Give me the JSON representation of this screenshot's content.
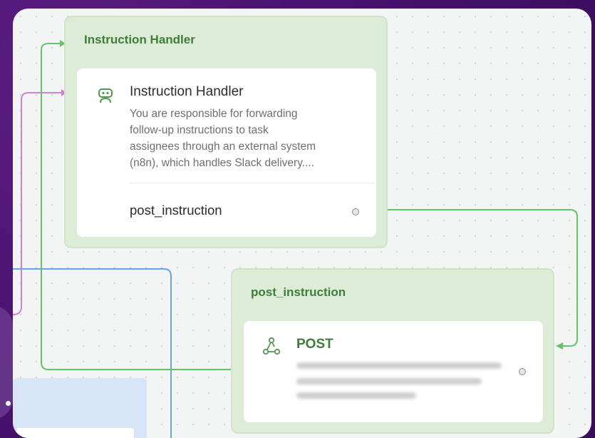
{
  "colors": {
    "group_bg": "#dcecd6",
    "group_title": "#3f7d3a",
    "edge_green": "#67c36b",
    "edge_pink": "#d67fd6",
    "edge_blue": "#6ea0e4"
  },
  "groups": [
    {
      "title": "Instruction Handler",
      "node": {
        "icon": "robot-icon",
        "title": "Instruction Handler",
        "description": [
          "You are responsible for forwarding",
          "follow-up instructions to task",
          "assignees through an external system",
          "(n8n), which handles Slack delivery...."
        ],
        "output_label": "post_instruction"
      }
    },
    {
      "title": "post_instruction",
      "node": {
        "icon": "webhook-icon",
        "method": "POST"
      }
    }
  ]
}
